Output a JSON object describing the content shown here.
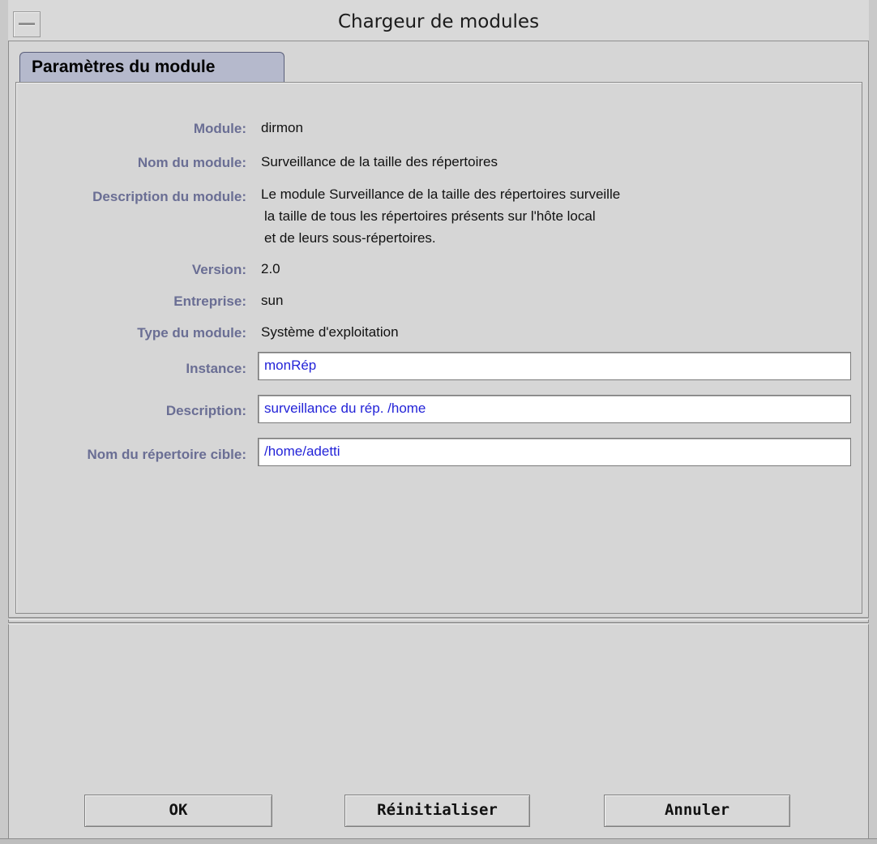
{
  "window": {
    "title": "Chargeur de modules"
  },
  "tab": {
    "label": "Paramètres du module"
  },
  "info": {
    "module_label": "Module:",
    "module_value": "dirmon",
    "name_label": "Nom du module:",
    "name_value": "Surveillance de la taille des répertoires",
    "description_label": "Description du module:",
    "description_lines": [
      "Le module Surveillance de la taille des répertoires surveille",
      "la taille de tous les répertoires présents sur l'hôte local",
      "et de leurs sous-répertoires."
    ],
    "version_label": "Version:",
    "version_value": "2.0",
    "company_label": "Entreprise:",
    "company_value": "sun",
    "type_label": "Type du module:",
    "type_value": "Système d'exploitation"
  },
  "fields": {
    "instance_label": "Instance:",
    "instance_value": "monRép",
    "description_label": "Description:",
    "description_value": "surveillance du rép. /home",
    "target_label": "Nom du répertoire cible:",
    "target_value": "/home/adetti"
  },
  "buttons": {
    "ok": "OK",
    "reset": "Réinitialiser",
    "cancel": "Annuler"
  },
  "colors": {
    "label": "#6a6e94",
    "field_text": "#2323d8",
    "tab": "#b5b9cc"
  }
}
